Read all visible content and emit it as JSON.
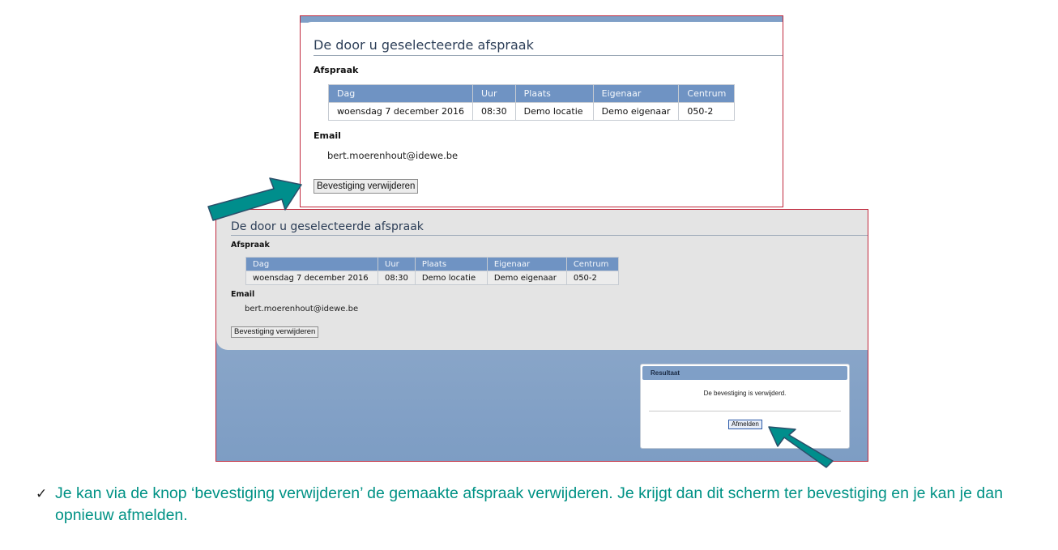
{
  "screen1": {
    "title": "De door u geselecteerde afspraak",
    "section_afspraak": "Afspraak",
    "table": {
      "headers": [
        "Dag",
        "Uur",
        "Plaats",
        "Eigenaar",
        "Centrum"
      ],
      "row": [
        "woensdag 7 december 2016",
        "08:30",
        "Demo locatie",
        "Demo eigenaar",
        "050-2"
      ]
    },
    "section_email": "Email",
    "email": "bert.moerenhout@idewe.be",
    "delete_button": "Bevestiging verwijderen"
  },
  "screen2": {
    "title": "De door u geselecteerde afspraak",
    "section_afspraak": "Afspraak",
    "table": {
      "headers": [
        "Dag",
        "Uur",
        "Plaats",
        "Eigenaar",
        "Centrum"
      ],
      "row": [
        "woensdag 7 december 2016",
        "08:30",
        "Demo locatie",
        "Demo eigenaar",
        "050-2"
      ]
    },
    "section_email": "Email",
    "email": "bert.moerenhout@idewe.be",
    "delete_button": "Bevestiging verwijderen",
    "dialog": {
      "title": "Resultaat",
      "message": "De bevestiging is verwijderd.",
      "logout_button": "Afmelden"
    }
  },
  "bullet": {
    "icon": "check-icon",
    "text": "Je kan via de knop ‘bevestiging verwijderen’ de gemaakte afspraak verwijderen. Je krijgt dan dit scherm ter bevestiging en je kan je dan opnieuw afmelden."
  },
  "colors": {
    "accent_text": "#009285",
    "arrow": "#008e8c",
    "header_blue": "#6f93c3",
    "frame_border": "#c0283c"
  }
}
